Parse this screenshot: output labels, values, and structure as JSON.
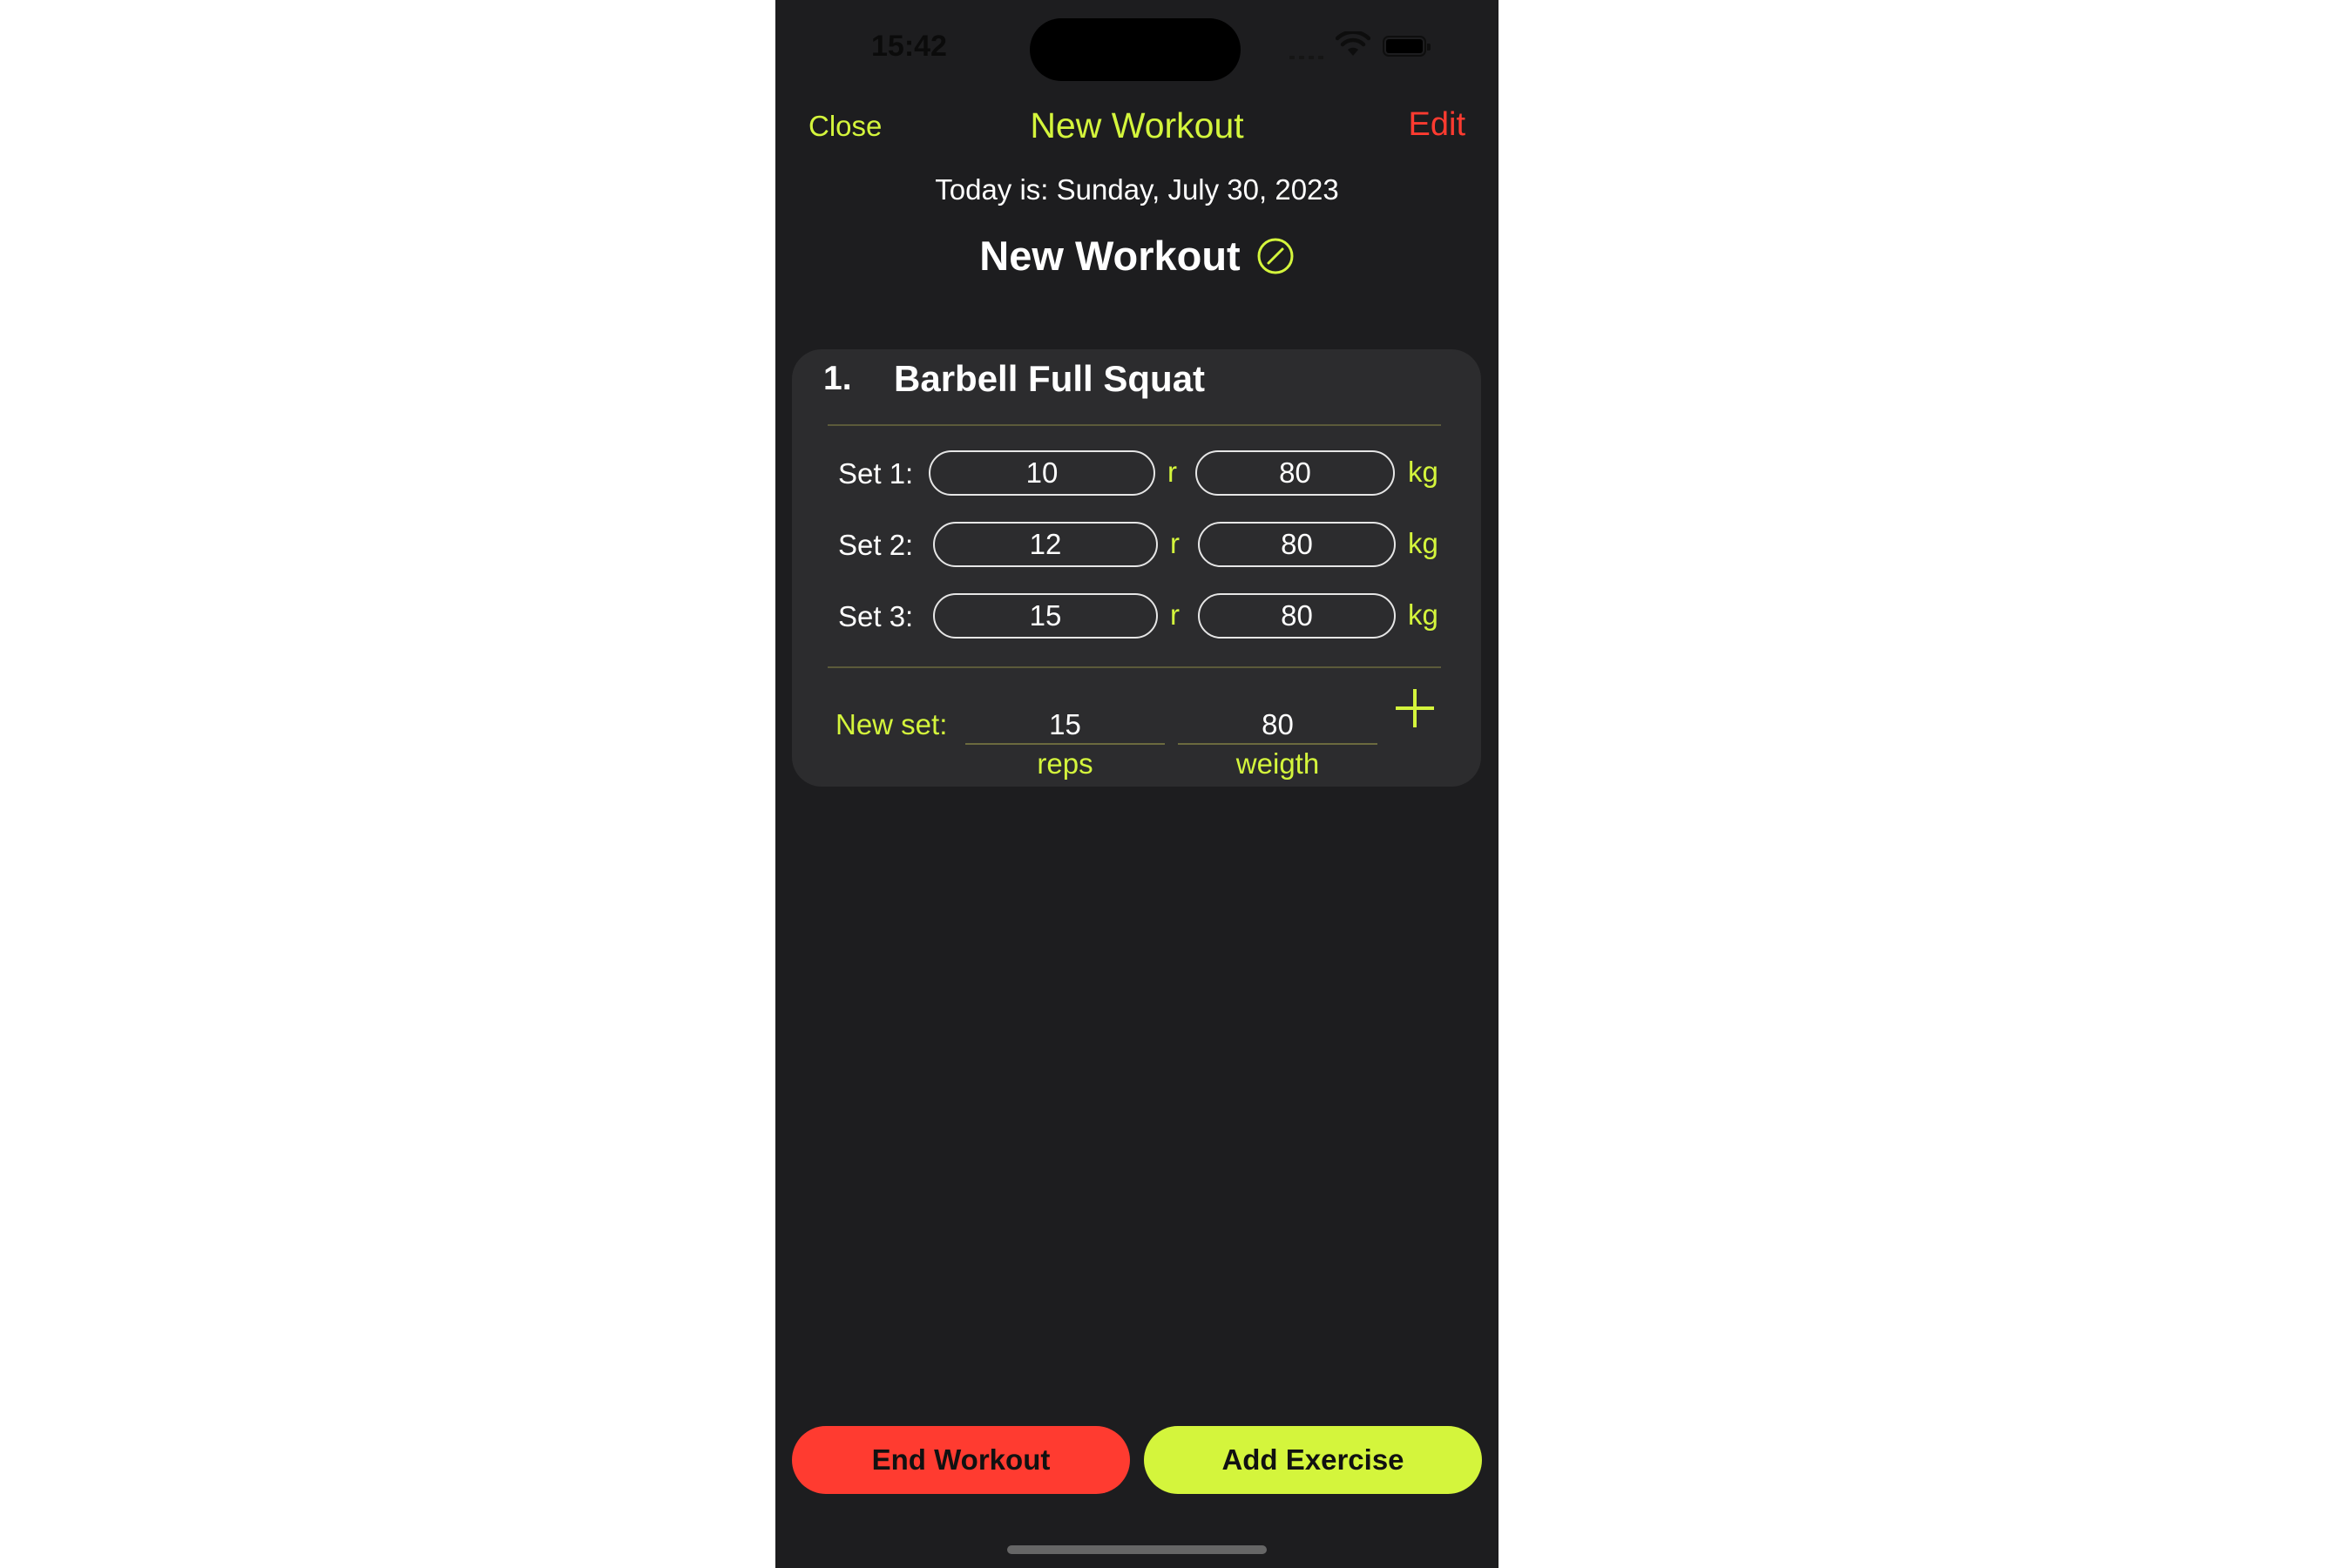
{
  "status_bar": {
    "time": "15:42"
  },
  "nav": {
    "close": "Close",
    "title": "New Workout",
    "edit": "Edit"
  },
  "date_line": "Today is: Sunday, July 30, 2023",
  "workout": {
    "name": "New Workout",
    "edit_icon": "pencil-circle-icon"
  },
  "exercise": {
    "number": "1.",
    "name": "Barbell Full Squat",
    "sets": [
      {
        "label": "Set 1:",
        "reps": "10",
        "reps_unit": "r",
        "weight": "80",
        "weight_unit": "kg"
      },
      {
        "label": "Set 2:",
        "reps": "12",
        "reps_unit": "r",
        "weight": "80",
        "weight_unit": "kg"
      },
      {
        "label": "Set 3:",
        "reps": "15",
        "reps_unit": "r",
        "weight": "80",
        "weight_unit": "kg"
      }
    ],
    "new_set": {
      "label": "New set:",
      "reps": "15",
      "reps_caption": "reps",
      "weight": "80",
      "weight_caption": "weigth"
    }
  },
  "buttons": {
    "end": "End Workout",
    "add": "Add Exercise"
  },
  "colors": {
    "accent": "#d4f53c",
    "danger": "#ff3b30",
    "background": "#1d1d1f",
    "card": "#2c2c2e"
  }
}
